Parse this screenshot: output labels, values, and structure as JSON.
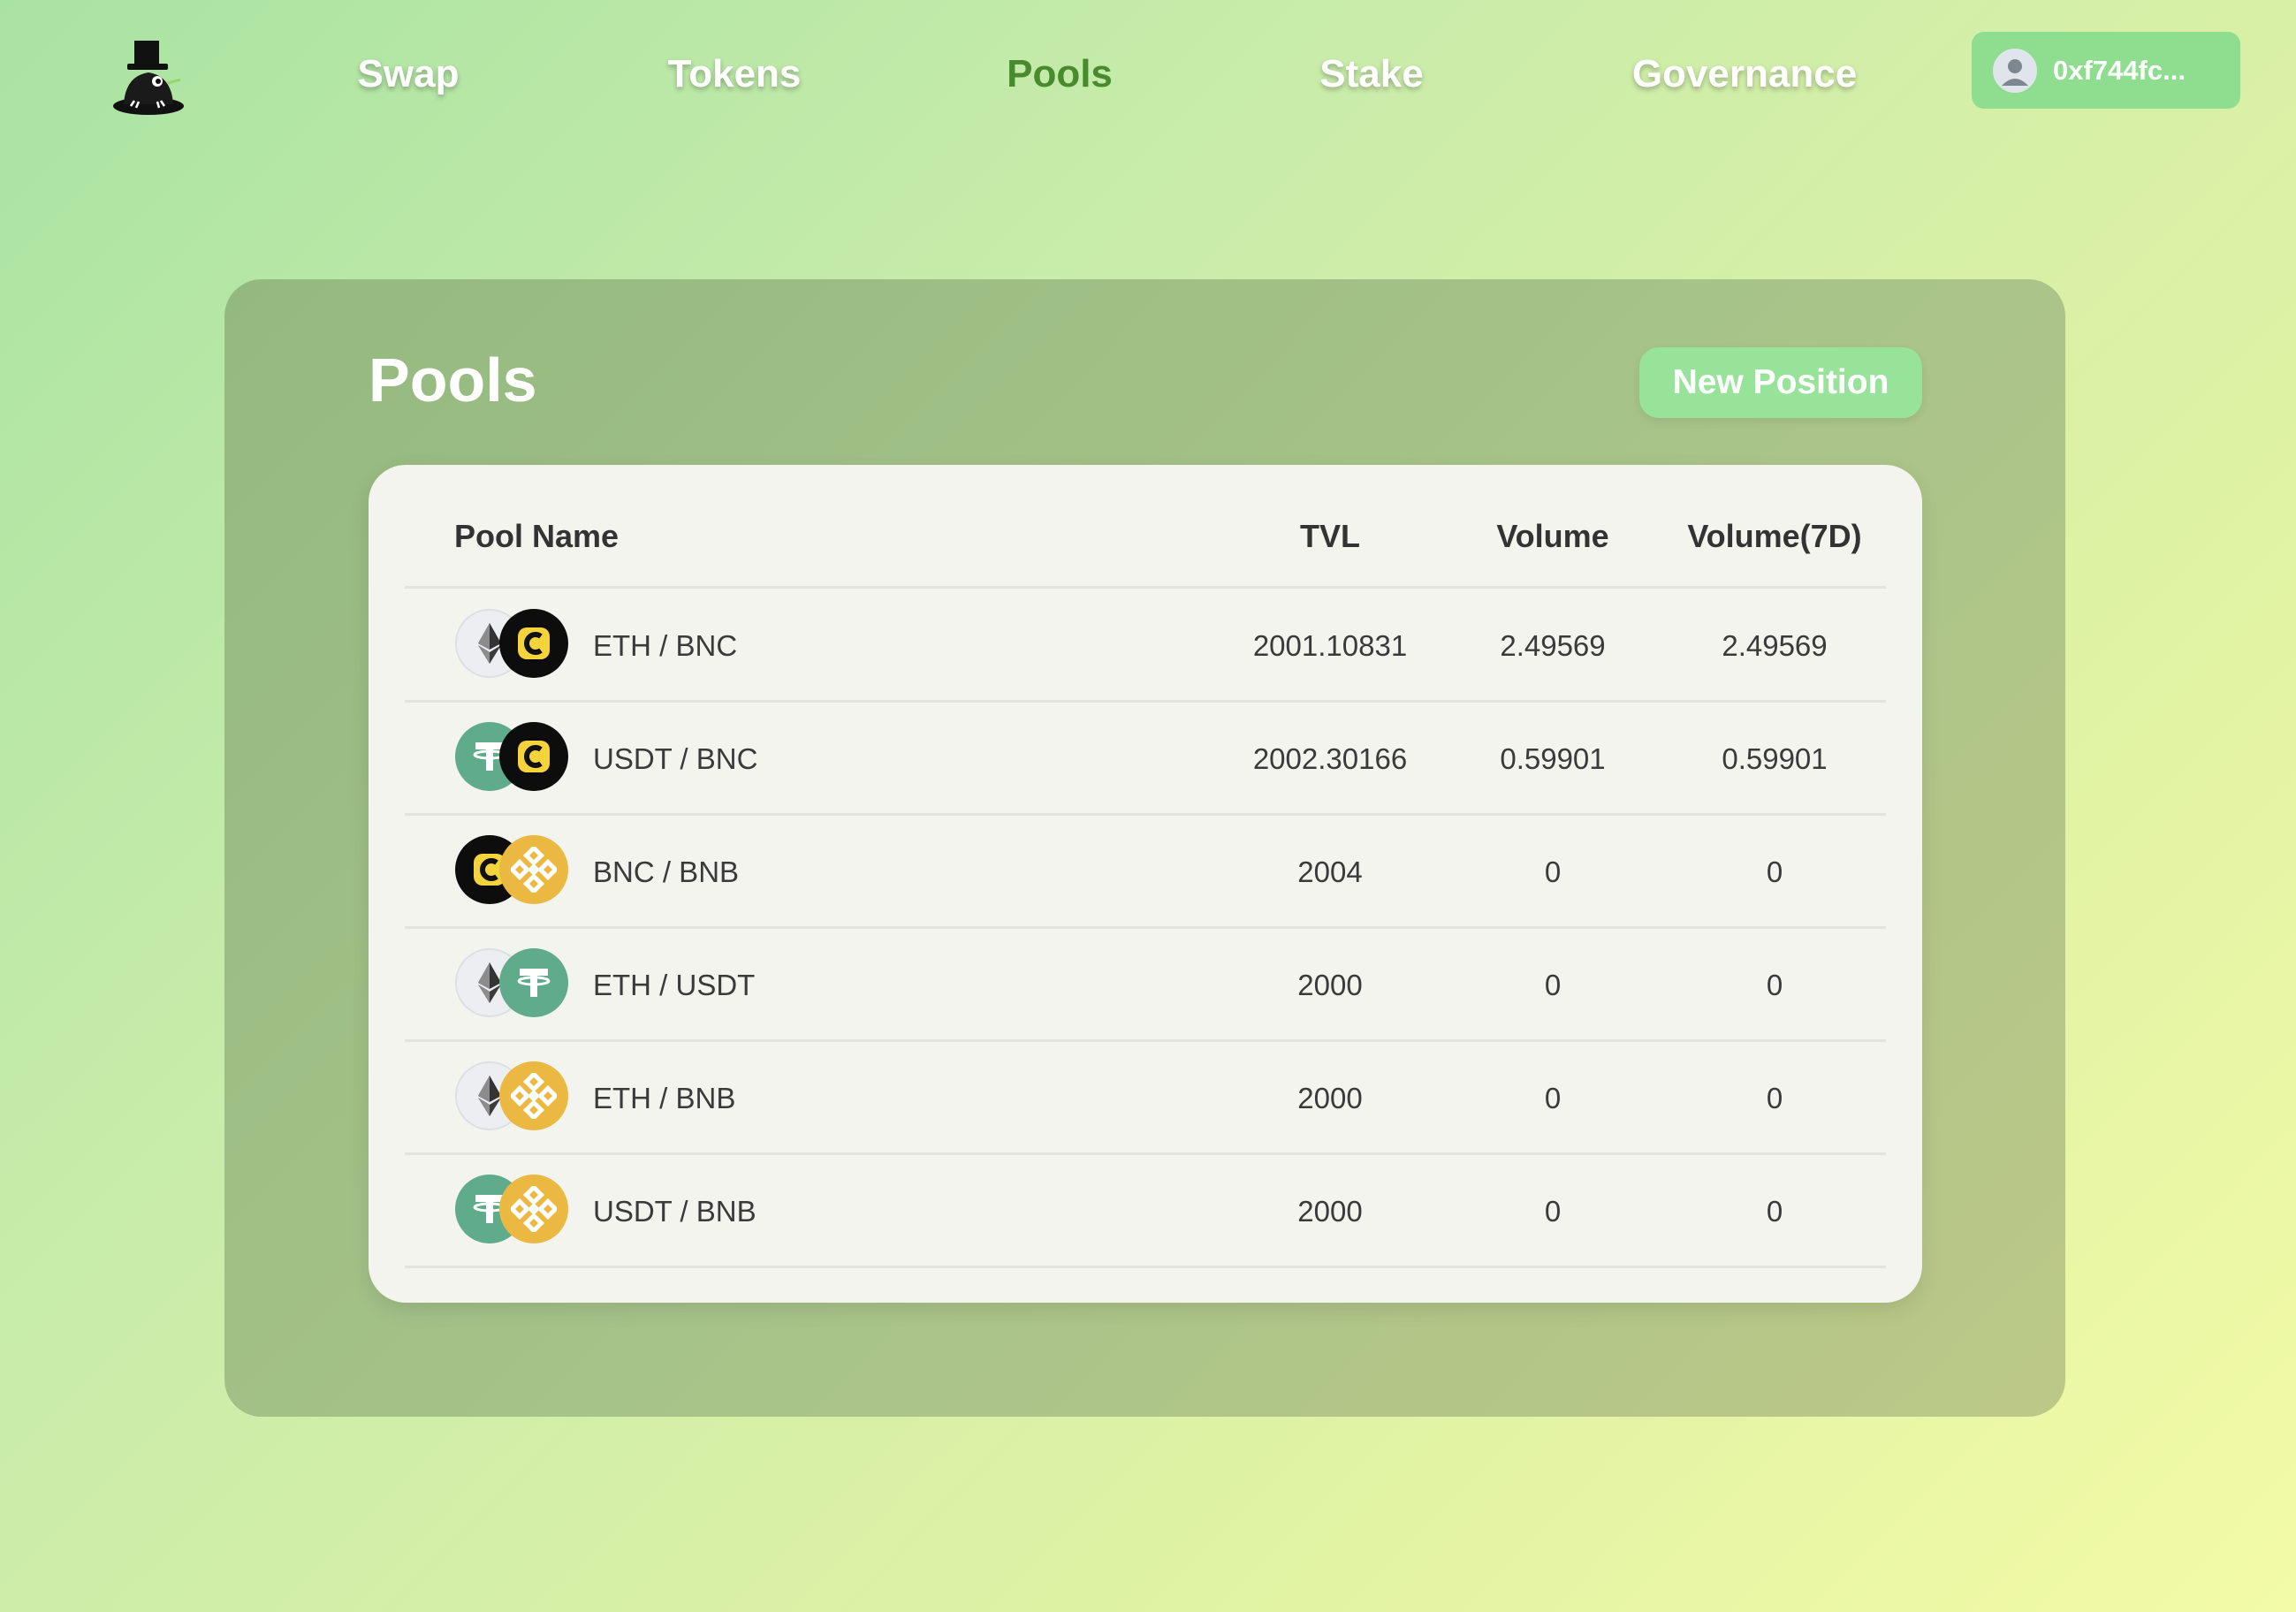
{
  "nav": {
    "links": [
      {
        "label": "Swap",
        "active": false
      },
      {
        "label": "Tokens",
        "active": false
      },
      {
        "label": "Pools",
        "active": true
      },
      {
        "label": "Stake",
        "active": false
      },
      {
        "label": "Governance",
        "active": false
      }
    ],
    "wallet_address": "0xf744fc..."
  },
  "page": {
    "title": "Pools",
    "new_position_label": "New Position"
  },
  "table": {
    "headers": {
      "pool_name": "Pool Name",
      "tvl": "TVL",
      "volume": "Volume",
      "volume_7d": "Volume(7D)"
    },
    "rows": [
      {
        "name": "ETH / BNC",
        "token_a": "eth-icon",
        "token_b": "bnc-icon",
        "tvl": "2001.10831",
        "volume": "2.49569",
        "volume_7d": "2.49569"
      },
      {
        "name": "USDT / BNC",
        "token_a": "usdt-icon",
        "token_b": "bnc-icon",
        "tvl": "2002.30166",
        "volume": "0.59901",
        "volume_7d": "0.59901"
      },
      {
        "name": "BNC / BNB",
        "token_a": "bnc-icon",
        "token_b": "bnb-icon",
        "tvl": "2004",
        "volume": "0",
        "volume_7d": "0"
      },
      {
        "name": "ETH / USDT",
        "token_a": "eth-icon",
        "token_b": "usdt-icon",
        "tvl": "2000",
        "volume": "0",
        "volume_7d": "0"
      },
      {
        "name": "ETH / BNB",
        "token_a": "eth-icon",
        "token_b": "bnb-icon",
        "tvl": "2000",
        "volume": "0",
        "volume_7d": "0"
      },
      {
        "name": "USDT / BNB",
        "token_a": "usdt-icon",
        "token_b": "bnb-icon",
        "tvl": "2000",
        "volume": "0",
        "volume_7d": "0"
      }
    ]
  },
  "colors": {
    "accent_green": "#98e39a",
    "active_nav": "#4a8a2e",
    "usdt": "#5fab8c",
    "bnb": "#ebb842",
    "bnc_bg": "#0d0d0d",
    "bnc_fg": "#f5d33d"
  }
}
